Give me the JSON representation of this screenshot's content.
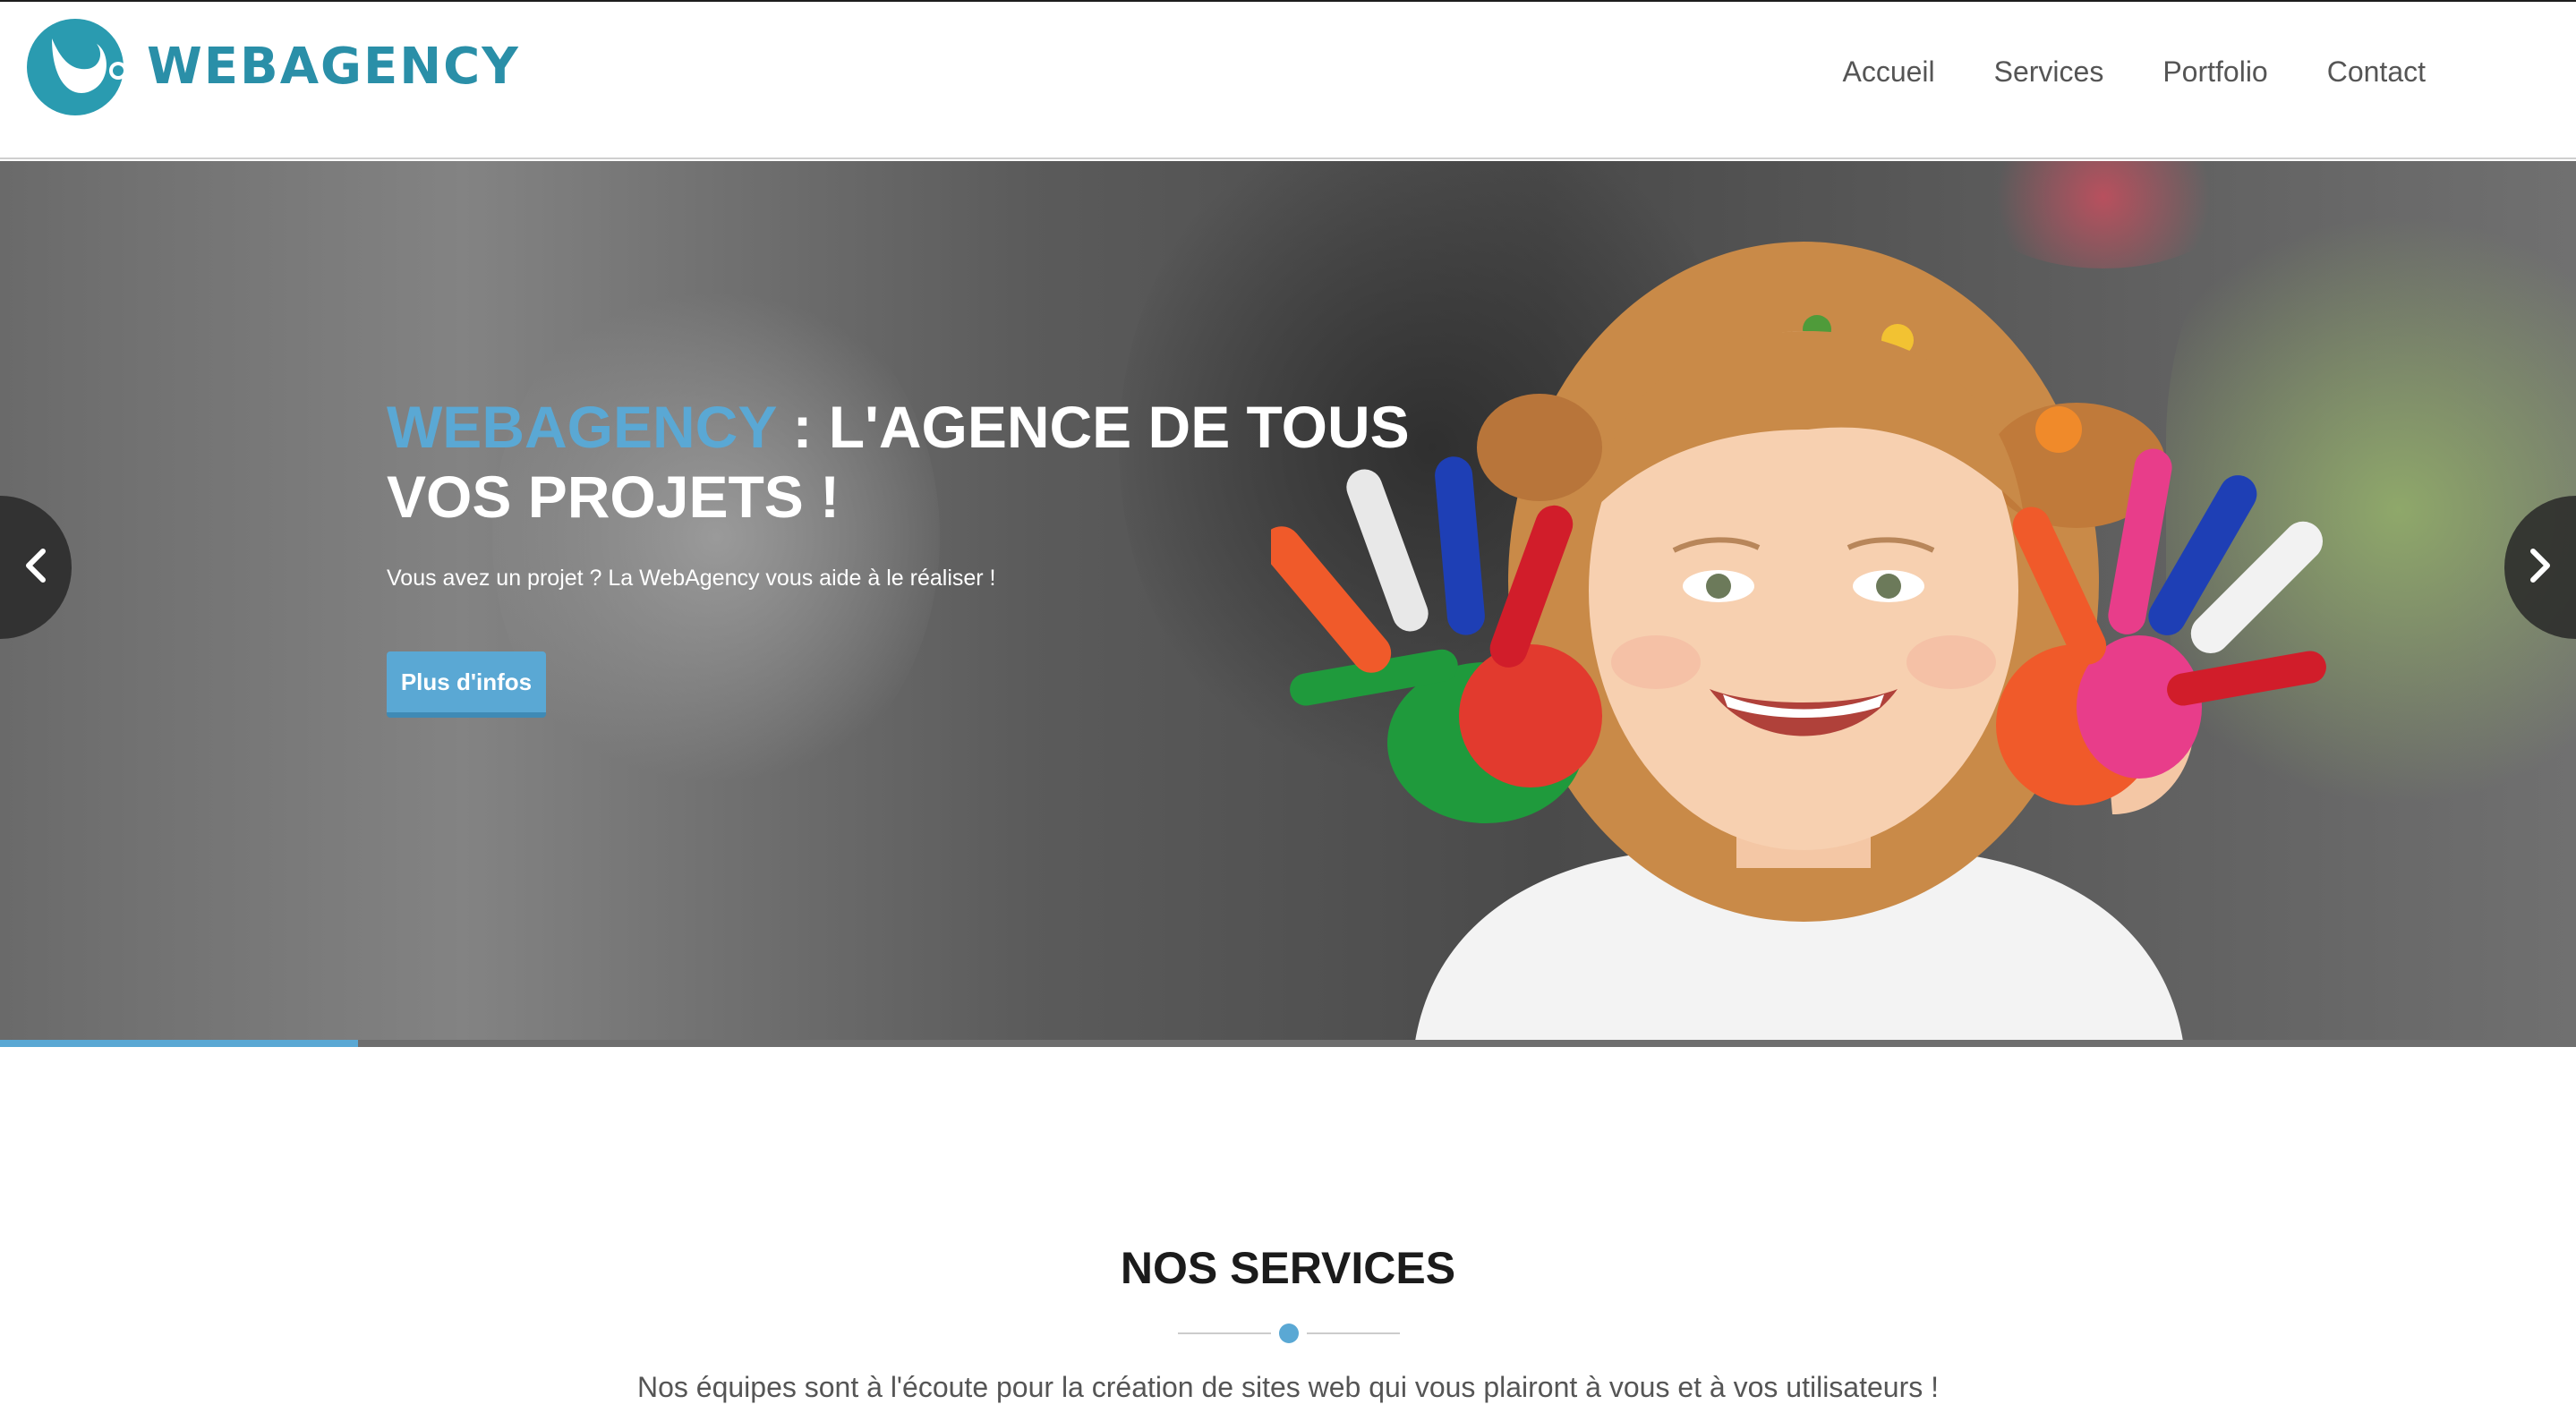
{
  "brand": {
    "name": "WEBAGENCY",
    "color": "#2a8fa8"
  },
  "nav": {
    "items": [
      "Accueil",
      "Services",
      "Portfolio",
      "Contact"
    ]
  },
  "hero": {
    "title_accent": "WEBAGENCY",
    "title_rest": " : L'AGENCE DE TOUS VOS PROJETS !",
    "subtitle": "Vous avez un projet ? La WebAgency vous aide à le réaliser !",
    "button_label": "Plus d'infos",
    "accent_color": "#5aa8d4",
    "slide_progress": 0.139
  },
  "services": {
    "title": "NOS SERVICES",
    "text": "Nos équipes sont à l'écoute pour la création de sites web qui vous plairont à vous et à vos utilisateurs !"
  }
}
